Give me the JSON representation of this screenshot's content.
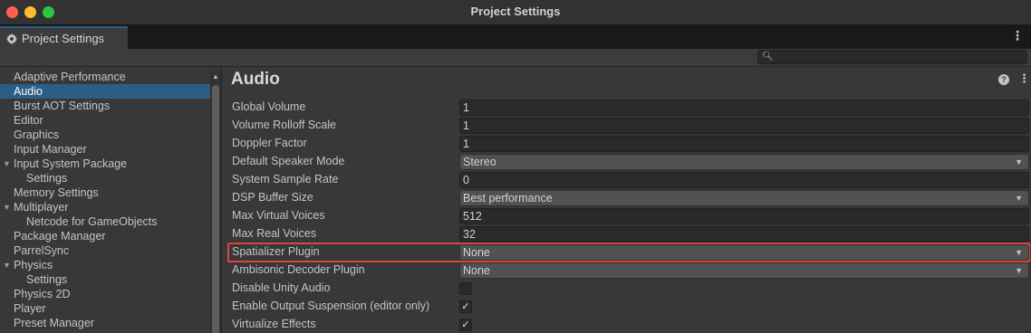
{
  "window": {
    "title": "Project Settings"
  },
  "tab": {
    "label": "Project Settings",
    "icon": "gear-icon"
  },
  "search": {
    "placeholder": "",
    "value": ""
  },
  "sidebar": {
    "items": [
      {
        "label": "Adaptive Performance",
        "indent": 0,
        "expanded": null,
        "selected": false
      },
      {
        "label": "Audio",
        "indent": 0,
        "expanded": null,
        "selected": true
      },
      {
        "label": "Burst AOT Settings",
        "indent": 0,
        "expanded": null,
        "selected": false
      },
      {
        "label": "Editor",
        "indent": 0,
        "expanded": null,
        "selected": false
      },
      {
        "label": "Graphics",
        "indent": 0,
        "expanded": null,
        "selected": false
      },
      {
        "label": "Input Manager",
        "indent": 0,
        "expanded": null,
        "selected": false
      },
      {
        "label": "Input System Package",
        "indent": 0,
        "expanded": true,
        "selected": false
      },
      {
        "label": "Settings",
        "indent": 1,
        "expanded": null,
        "selected": false
      },
      {
        "label": "Memory Settings",
        "indent": 0,
        "expanded": null,
        "selected": false
      },
      {
        "label": "Multiplayer",
        "indent": 0,
        "expanded": true,
        "selected": false
      },
      {
        "label": "Netcode for GameObjects",
        "indent": 1,
        "expanded": null,
        "selected": false
      },
      {
        "label": "Package Manager",
        "indent": 0,
        "expanded": null,
        "selected": false
      },
      {
        "label": "ParrelSync",
        "indent": 0,
        "expanded": null,
        "selected": false
      },
      {
        "label": "Physics",
        "indent": 0,
        "expanded": true,
        "selected": false
      },
      {
        "label": "Settings",
        "indent": 1,
        "expanded": null,
        "selected": false
      },
      {
        "label": "Physics 2D",
        "indent": 0,
        "expanded": null,
        "selected": false
      },
      {
        "label": "Player",
        "indent": 0,
        "expanded": null,
        "selected": false
      },
      {
        "label": "Preset Manager",
        "indent": 0,
        "expanded": null,
        "selected": false
      }
    ]
  },
  "main": {
    "title": "Audio",
    "properties": [
      {
        "name": "global-volume",
        "label": "Global Volume",
        "type": "text",
        "value": "1"
      },
      {
        "name": "volume-rolloff-scale",
        "label": "Volume Rolloff Scale",
        "type": "text",
        "value": "1"
      },
      {
        "name": "doppler-factor",
        "label": "Doppler Factor",
        "type": "text",
        "value": "1"
      },
      {
        "name": "default-speaker-mode",
        "label": "Default Speaker Mode",
        "type": "dropdown",
        "value": "Stereo"
      },
      {
        "name": "system-sample-rate",
        "label": "System Sample Rate",
        "type": "text",
        "value": "0"
      },
      {
        "name": "dsp-buffer-size",
        "label": "DSP Buffer Size",
        "type": "dropdown",
        "value": "Best performance"
      },
      {
        "name": "max-virtual-voices",
        "label": "Max Virtual Voices",
        "type": "text",
        "value": "512"
      },
      {
        "name": "max-real-voices",
        "label": "Max Real Voices",
        "type": "text",
        "value": "32"
      },
      {
        "name": "spatializer-plugin",
        "label": "Spatializer Plugin",
        "type": "dropdown",
        "value": "None",
        "highlighted": true
      },
      {
        "name": "ambisonic-decoder-plugin",
        "label": "Ambisonic Decoder Plugin",
        "type": "dropdown",
        "value": "None"
      },
      {
        "name": "disable-unity-audio",
        "label": "Disable Unity Audio",
        "type": "checkbox",
        "checked": false
      },
      {
        "name": "enable-output-suspension",
        "label": "Enable Output Suspension (editor only)",
        "type": "checkbox",
        "checked": true
      },
      {
        "name": "virtualize-effects",
        "label": "Virtualize Effects",
        "type": "checkbox",
        "checked": true
      }
    ]
  },
  "colors": {
    "accent": "#2c5d87",
    "highlight": "#e0443e",
    "traffic_close": "#ff5f57",
    "traffic_min": "#febc2e",
    "traffic_max": "#28c840"
  }
}
